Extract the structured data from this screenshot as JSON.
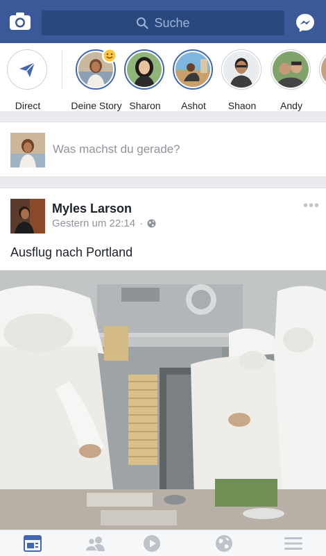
{
  "header": {
    "search_placeholder": "Suche",
    "icons": [
      "camera-icon",
      "search-icon",
      "messenger-icon"
    ],
    "colors": {
      "bar": "#3b5998",
      "search_bg": "#29487d"
    }
  },
  "stories": {
    "direct_label": "Direct",
    "items": [
      {
        "label": "Deine Story"
      },
      {
        "label": "Sharon"
      },
      {
        "label": "Ashot"
      },
      {
        "label": "Shaon"
      },
      {
        "label": "Andy"
      }
    ]
  },
  "composer": {
    "prompt": "Was machst du gerade?"
  },
  "post": {
    "author": "Myles Larson",
    "timestamp": "Gestern um 22:14",
    "separator": "·",
    "more": "•••",
    "text": "Ausflug nach Portland"
  },
  "tabbar": {
    "active": "news-feed",
    "icons": [
      "news-feed-icon",
      "friends-icon",
      "video-icon",
      "globe-icon",
      "menu-icon"
    ],
    "colors": {
      "active": "#4267b2",
      "inactive": "#bec2c9"
    }
  }
}
